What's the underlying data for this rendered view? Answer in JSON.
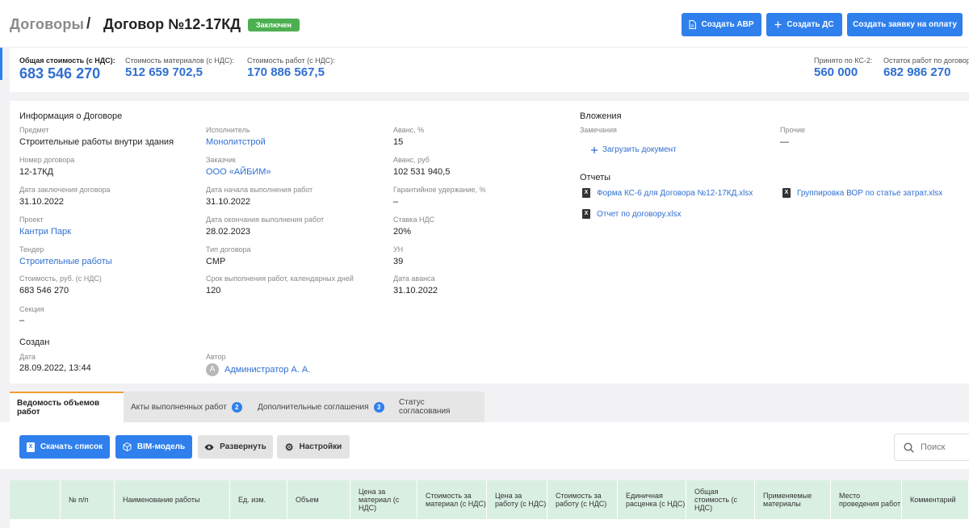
{
  "header": {
    "breadcrumb_parent": "Договоры",
    "breadcrumb_separator": "/",
    "title": "Договор №12-17КД",
    "status": "Заключен",
    "btn_avr": "Создать АВР",
    "btn_ds": "Создать ДС",
    "btn_payment": "Создать заявку на оплату"
  },
  "summary": {
    "total_label": "Общая стоимость (с НДС):",
    "total_value": "683 546 270",
    "materials_label": "Стоимость материалов (с НДС):",
    "materials_value": "512 659 702,5",
    "works_label": "Стоимость работ (с НДС):",
    "works_value": "170 886 567,5",
    "accepted_label": "Принято по КС-2:",
    "accepted_value": "560 000",
    "remaining_label": "Остаток работ по договору:",
    "remaining_value": "682 986 270"
  },
  "info": {
    "title": "Информация о Договоре",
    "subject_label": "Предмет",
    "subject_value": "Строительные работы внутри здания",
    "number_label": "Номер договора",
    "number_value": "12-17КД",
    "date_label": "Дата заключения договора",
    "date_value": "31.10.2022",
    "project_label": "Проект",
    "project_value": "Кантри Парк",
    "tender_label": "Тендер",
    "tender_value": "Строительные работы",
    "cost_label": "Стоимость, руб. (с НДС)",
    "cost_value": "683 546 270",
    "section_label": "Секция",
    "section_value": "–",
    "contractor_label": "Исполнитель",
    "contractor_value": "Монолитстрой",
    "customer_label": "Заказчик",
    "customer_value": "ООО «АЙБИМ»",
    "start_label": "Дата начала выполнения работ",
    "start_value": "31.10.2022",
    "end_label": "Дата окончания выполнения работ",
    "end_value": "28.02.2023",
    "type_label": "Тип договора",
    "type_value": "СМР",
    "term_label": "Срок выполнения работ, календарных дней",
    "term_value": "120",
    "advance_pct_label": "Аванс, %",
    "advance_pct_value": "15",
    "advance_rub_label": "Аванс, руб",
    "advance_rub_value": "102 531 940,5",
    "guarantee_label": "Гарантийное удержание, %",
    "guarantee_value": "–",
    "vat_label": "Ставка НДС",
    "vat_value": "20%",
    "un_label": "УН",
    "un_value": "39",
    "advance_date_label": "Дата аванса",
    "advance_date_value": "31.10.2022",
    "created_title": "Создан",
    "created_date_label": "Дата",
    "created_date_value": "28.09.2022, 13:44",
    "author_label": "Автор",
    "author_initial": "А",
    "author_value": "Администратор А. А."
  },
  "attachments": {
    "title": "Вложения",
    "remarks_label": "Замечания",
    "upload": "Загрузить документ",
    "other_label": "Прочие",
    "other_value": "—",
    "reports_title": "Отчеты",
    "file1": "Форма КС-6 для Договора №12-17КД.xlsx",
    "file2": "Группировка ВОР по статье затрат.xlsx",
    "file3": "Отчет по договору.xlsx"
  },
  "tabs": [
    {
      "label": "Ведомость объемов работ"
    },
    {
      "label": "Акты выполненных работ",
      "count": "2"
    },
    {
      "label": "Дополнительные соглашения",
      "count": "3"
    },
    {
      "label": "Статус согласования"
    }
  ],
  "toolbar": {
    "download": "Скачать список",
    "bim": "BIM-модель",
    "expand": "Развернуть",
    "settings": "Настройки",
    "search_placeholder": "Поиск"
  },
  "table": {
    "columns": [
      "",
      "№ п/п",
      "Наименование работы",
      "Ед. изм.",
      "Объем",
      "Цена за материал (с НДС)",
      "Стоимость за материал (с НДС)",
      "Цена за работу (с НДС)",
      "Стоимость за работу (с НДС)",
      "Единичная расценка (с НДС)",
      "Общая стоимость (с НДС)",
      "Применяемые материалы",
      "Место проведения работ",
      "Комментарий"
    ]
  },
  "colors": {
    "accent": "#2f80ed",
    "status_green": "#4caf50",
    "link": "#2f6fd1",
    "table_header": "#d9efe2",
    "active_tab_border": "#f0a030"
  }
}
